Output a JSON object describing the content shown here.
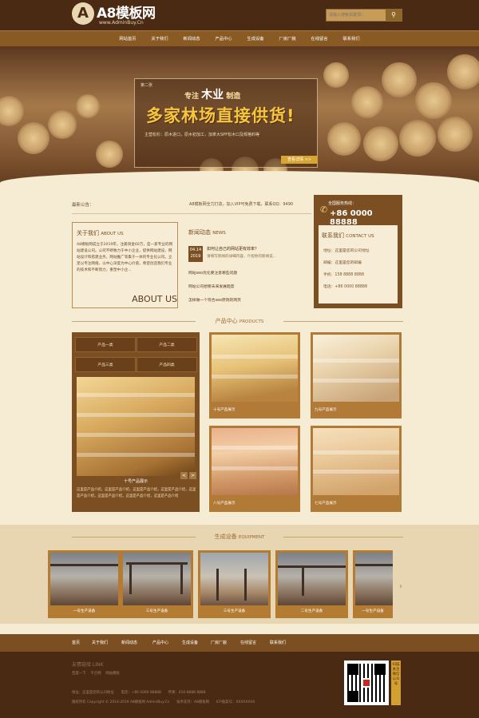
{
  "header": {
    "logo_mark": "A",
    "logo_title": "A8模板网",
    "logo_sub": "www.AdminBuy.Cn",
    "search_placeholder": "请输入搜索关键词！",
    "search_icon": "search-icon"
  },
  "nav": [
    "网站首页",
    "关于我们",
    "新闻动态",
    "产品中心",
    "生成设备",
    "厂房厂貌",
    "在线留言",
    "联系我们"
  ],
  "banner": {
    "tag": "第二张",
    "sub_prefix": "专注",
    "sub_big": "木业",
    "sub_suffix": "制造",
    "main": "多家林场直接供货!",
    "desc": "主营松杉：原木进口，原木初加工，加拿大SPF松木口及规格料等",
    "more": "查看详情 >>"
  },
  "notice": {
    "label": "最新公告：",
    "text": "A8模板网全力打造，加入VIP可免费下载，联系QQ：9490"
  },
  "hotline": {
    "label": "全国服务热线：",
    "number": "+86 0000 88888"
  },
  "contact": {
    "title": "联系我们",
    "title_en": "CONTACT US",
    "lines": [
      "地址：这里是您的公司地址",
      "邮编：这里是您的邮编",
      "手机：158 8888 8888",
      "电话：+86 0000 88888"
    ]
  },
  "about": {
    "title": "关于我们",
    "title_en": "ABOUT US",
    "text": "A8模板网成立于2019年，注册资金60万，是一家专业的网站建设公司。公司不断致力于中小企业，提供网站建设，网站设计和搭建业务，网站推广等集于一体的专业化公司。立足以专注网络，以中心深度为中心价值，希望创造我们专业的技术和不断努力，重塑中小企...",
    "big": "ABOUT US"
  },
  "news": {
    "title": "新闻动态",
    "title_en": "NEWS",
    "date_day": "04.14",
    "date_year": "2019",
    "headline": "如何让自己的网站更有效率？",
    "summary": "请填写新闻的详细内容，介绍你的新闻说...",
    "items": [
      "网站seo优化要注意哪些问题",
      "网站公司想要未来发展趋势",
      "怎样做一个符合seo原则的网页"
    ]
  },
  "products": {
    "title": "产品中心",
    "title_en": "PRODUCTS",
    "categories": [
      "产品一类",
      "产品二类",
      "产品三类",
      "产品四类"
    ],
    "featured_caption": "十号产品展示",
    "featured_desc": "这里是产品介绍，这里是产品介绍，这里是产品介绍，这里是产品介绍，这里是产品介绍，这里是产品介绍，这里是产品介绍，这里是产品介绍",
    "cards": [
      "十号产品展示",
      "九号产品展示",
      "八号产品展示",
      "七号产品展示"
    ],
    "prev": "<",
    "next": ">"
  },
  "equipment": {
    "title": "生成设备",
    "title_en": "EQUIPMENT",
    "cards": [
      "一号生产设备",
      "三号生产设备",
      "三号生产设备",
      "二号生产设备",
      "一号生产设备"
    ],
    "prev": "‹",
    "next": "›"
  },
  "footer_nav": [
    "首页",
    "关于我们",
    "新闻动态",
    "产品中心",
    "生成设备",
    "厂房厂貌",
    "在线留言",
    "联系我们"
  ],
  "footer": {
    "title": "友情链接 LINK",
    "links": [
      "百度一下",
      "千企网",
      "网站模板"
    ],
    "line1": "地址：这里是您的公司地址　　电话：+86 0000 88888　　传真：010-8888 8888",
    "line2": "版权所有 Copyright © 2014-2019 A8模板网 AdminBuy.Cn　　技术支持：A8模板网　　ICP备案号：XXXXXXXX",
    "qr_tag": "扫描关注微信公众号"
  }
}
